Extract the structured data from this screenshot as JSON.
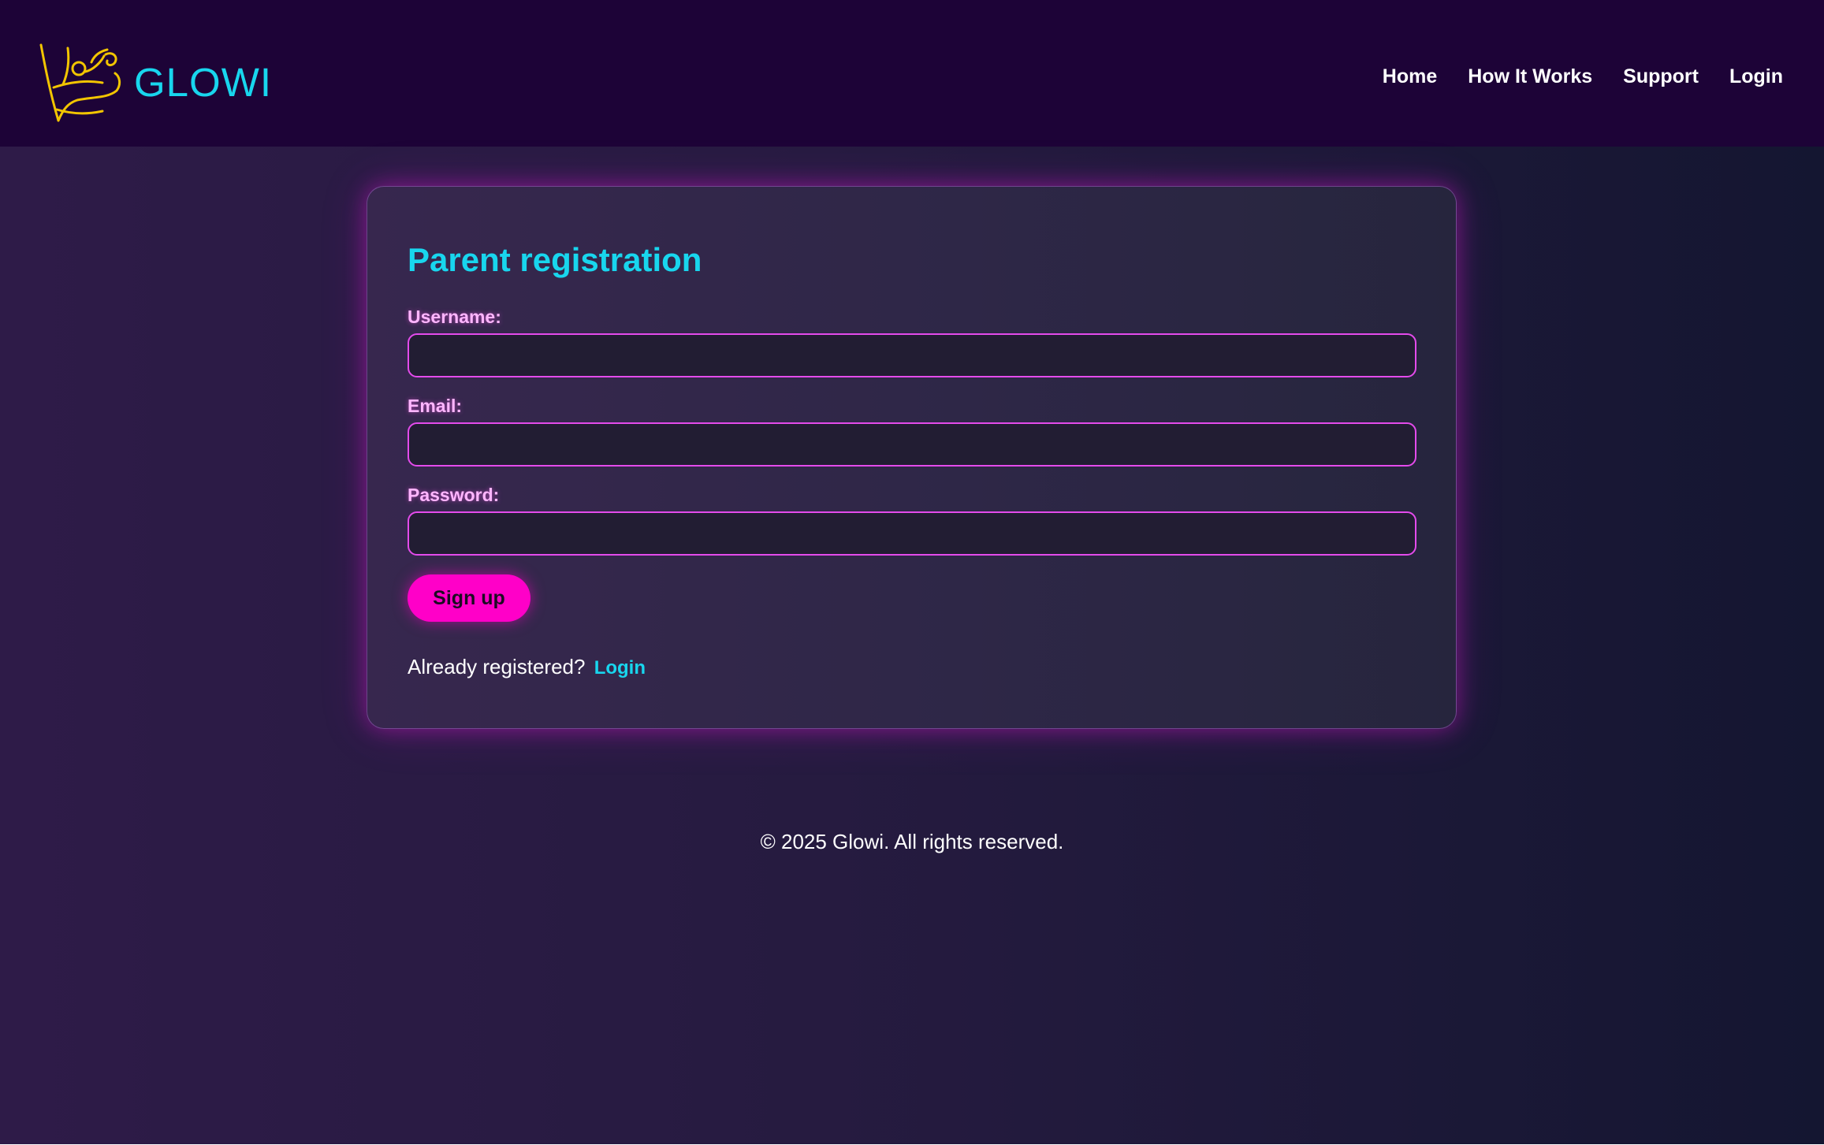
{
  "colors": {
    "accent_cyan": "#18d6ee",
    "accent_pink": "#ff00c8",
    "header_bg": "#1d0337",
    "label_pink": "#ffb6ff",
    "input_border": "#e44bec",
    "logo_yellow": "#f2c500"
  },
  "header": {
    "logo_icon": "dancing-figure-icon",
    "brand_name": "GLOWI",
    "nav": [
      {
        "label": "Home"
      },
      {
        "label": "How It Works"
      },
      {
        "label": "Support"
      },
      {
        "label": "Login"
      }
    ]
  },
  "form": {
    "title": "Parent registration",
    "fields": [
      {
        "label": "Username:",
        "value": ""
      },
      {
        "label": "Email:",
        "value": ""
      },
      {
        "label": "Password:",
        "value": ""
      }
    ],
    "submit_label": "Sign up",
    "login_prompt": "Already registered?",
    "login_link": "Login"
  },
  "footer": {
    "text": "© 2025 Glowi. All rights reserved."
  }
}
